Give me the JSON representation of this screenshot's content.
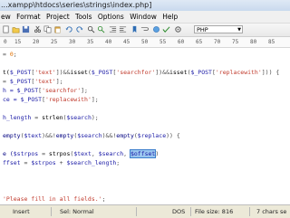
{
  "window": {
    "title": "...xampp\\htdocs\\series\\strings\\index.php]"
  },
  "menu": {
    "items": [
      "ew",
      "Format",
      "Project",
      "Tools",
      "Options",
      "Window",
      "Help"
    ]
  },
  "toolbar": {
    "language": "PHP"
  },
  "ruler": {
    "ticks": [
      "0",
      "15",
      "20",
      "25",
      "30",
      "35",
      "40",
      "45",
      "50",
      "55",
      "60",
      "65",
      "70",
      "75",
      "80",
      "85"
    ]
  },
  "editor": {
    "lines": [
      {
        "segments": [
          {
            "t": "= ",
            "c": "o"
          },
          {
            "t": "0",
            "c": "n"
          },
          {
            "t": ";",
            "c": "o"
          }
        ]
      },
      {
        "segments": []
      },
      {
        "segments": [
          {
            "t": "t(",
            "c": "f"
          },
          {
            "t": "$_POST",
            "c": "v"
          },
          {
            "t": "[",
            "c": "o"
          },
          {
            "t": "'text'",
            "c": "s"
          },
          {
            "t": "])&&",
            "c": "o"
          },
          {
            "t": "isset",
            "c": "f"
          },
          {
            "t": "(",
            "c": "o"
          },
          {
            "t": "$_POST",
            "c": "v"
          },
          {
            "t": "[",
            "c": "o"
          },
          {
            "t": "'searchfor'",
            "c": "s"
          },
          {
            "t": "])&&",
            "c": "o"
          },
          {
            "t": "isset",
            "c": "f"
          },
          {
            "t": "(",
            "c": "o"
          },
          {
            "t": "$_POST",
            "c": "v"
          },
          {
            "t": "[",
            "c": "o"
          },
          {
            "t": "'replacewith'",
            "c": "s"
          },
          {
            "t": "])) {",
            "c": "o"
          }
        ]
      },
      {
        "segments": [
          {
            "t": "= ",
            "c": "o"
          },
          {
            "t": "$_POST",
            "c": "v"
          },
          {
            "t": "[",
            "c": "o"
          },
          {
            "t": "'text'",
            "c": "s"
          },
          {
            "t": "];",
            "c": "o"
          }
        ]
      },
      {
        "segments": [
          {
            "t": "h = ",
            "c": "v"
          },
          {
            "t": "$_POST",
            "c": "v"
          },
          {
            "t": "[",
            "c": "o"
          },
          {
            "t": "'searchfor'",
            "c": "s"
          },
          {
            "t": "];",
            "c": "o"
          }
        ]
      },
      {
        "segments": [
          {
            "t": "ce = ",
            "c": "v"
          },
          {
            "t": "$_POST",
            "c": "v"
          },
          {
            "t": "[",
            "c": "o"
          },
          {
            "t": "'replacewith'",
            "c": "s"
          },
          {
            "t": "];",
            "c": "o"
          }
        ]
      },
      {
        "segments": []
      },
      {
        "segments": [
          {
            "t": "h_length",
            "c": "v"
          },
          {
            "t": " = ",
            "c": "o"
          },
          {
            "t": "strlen",
            "c": "f"
          },
          {
            "t": "(",
            "c": "o"
          },
          {
            "t": "$search",
            "c": "v"
          },
          {
            "t": ");",
            "c": "o"
          }
        ]
      },
      {
        "segments": []
      },
      {
        "segments": [
          {
            "t": "empty",
            "c": "k"
          },
          {
            "t": "(",
            "c": "o"
          },
          {
            "t": "$text",
            "c": "v"
          },
          {
            "t": ")&&!",
            "c": "o"
          },
          {
            "t": "empty",
            "c": "k"
          },
          {
            "t": "(",
            "c": "o"
          },
          {
            "t": "$search",
            "c": "v"
          },
          {
            "t": ")&&!",
            "c": "o"
          },
          {
            "t": "empty",
            "c": "k"
          },
          {
            "t": "(",
            "c": "o"
          },
          {
            "t": "$replace",
            "c": "v"
          },
          {
            "t": ")) {",
            "c": "o"
          }
        ]
      },
      {
        "segments": []
      },
      {
        "segments": [
          {
            "t": "e (",
            "c": "k"
          },
          {
            "t": "$strpos",
            "c": "v"
          },
          {
            "t": " = ",
            "c": "o"
          },
          {
            "t": "strpos",
            "c": "f"
          },
          {
            "t": "(",
            "c": "o"
          },
          {
            "t": "$text",
            "c": "v"
          },
          {
            "t": ", ",
            "c": "o"
          },
          {
            "t": "$search",
            "c": "v"
          },
          {
            "t": ", ",
            "c": "o"
          },
          {
            "t": "$offset",
            "c": "hl"
          },
          {
            "t": ")",
            "c": "o"
          }
        ]
      },
      {
        "segments": [
          {
            "t": "ffset",
            "c": "v"
          },
          {
            "t": " = ",
            "c": "o"
          },
          {
            "t": "$strpos",
            "c": "v"
          },
          {
            "t": " + ",
            "c": "o"
          },
          {
            "t": "$search_length",
            "c": "v"
          },
          {
            "t": ";",
            "c": "o"
          }
        ]
      },
      {
        "segments": []
      },
      {
        "segments": []
      },
      {
        "segments": []
      },
      {
        "segments": [
          {
            "t": "'Please fill in all fields.'",
            "c": "s"
          },
          {
            "t": ";",
            "c": "o"
          }
        ]
      }
    ]
  },
  "status": {
    "mode": "Insert",
    "selection": "Sel: Normal",
    "line_ending": "DOS",
    "file_size": "File size: 816",
    "chars_selected": "7 chars se"
  }
}
